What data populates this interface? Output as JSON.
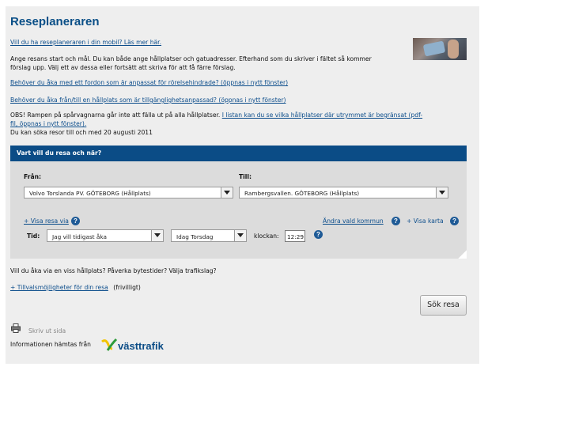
{
  "page_title": "Reseplaneraren",
  "intro": {
    "mobile_link": "Vill du ha reseplaneraren i din mobil? Läs mer här.",
    "description_line1": "Ange resans start och mål. Du kan både ange hållplatser och gatuadresser. Efterhand som du skriver i fältet så kommer",
    "description_line2": "förslag upp. Välj ett av dessa eller fortsätt att skriva för att få färre förslag.",
    "vehicle_link": "Behöver du åka med ett fordon som är anpassat för rörelsehindrade? (öppnas i nytt fönster)",
    "stop_link": "Behöver du åka från/till en hållplats som är tillgänglighetsanpassad? (öppnas i nytt fönster)",
    "obs_text": "OBS! Rampen på spårvagnarna går inte att fälla ut på alla hållplatser.",
    "obs_link_part1": "I listan kan du se vilka hållplatser där utrymmet är begränsat (pdf-",
    "obs_link_part2": "fil, öppnas i nytt fönster).",
    "search_until": "Du kan söka resor till och med 20 augusti 2011"
  },
  "form": {
    "header": "Vart vill du resa och när?",
    "from_label": "Från:",
    "from_value": "Volvo Torslanda PV. GÖTEBORG (Hållplats)",
    "to_label": "Till:",
    "to_value": "Rambergsvallen. GÖTEBORG (Hållplats)",
    "via_link": "+ Visa resa via",
    "municipality_link": "Ändra vald kommun",
    "map_link": "+ Visa karta",
    "time_label": "Tid:",
    "time_mode": "Jag vill tidigast åka",
    "day": "Idag Torsdag",
    "clock_label": "klockan:",
    "clock_value": "12:29",
    "help_glyph": "?"
  },
  "options": {
    "question": "Vill du åka via en viss hållplats? Påverka bytestider? Välja trafikslag?",
    "options_link": "+ Tillvalsmöjligheter för din resa",
    "optional": "(frivilligt)"
  },
  "search_button": "Sök resa",
  "footer": {
    "print_link": "Skriv ut sida",
    "info_text": "Informationen hämtas från",
    "logo_text": "västtrafik"
  },
  "colors": {
    "brand_blue": "#0b4c86",
    "link_blue": "#0d4e8c",
    "logo_yellow": "#f2c400",
    "logo_green": "#2d9b3a"
  }
}
